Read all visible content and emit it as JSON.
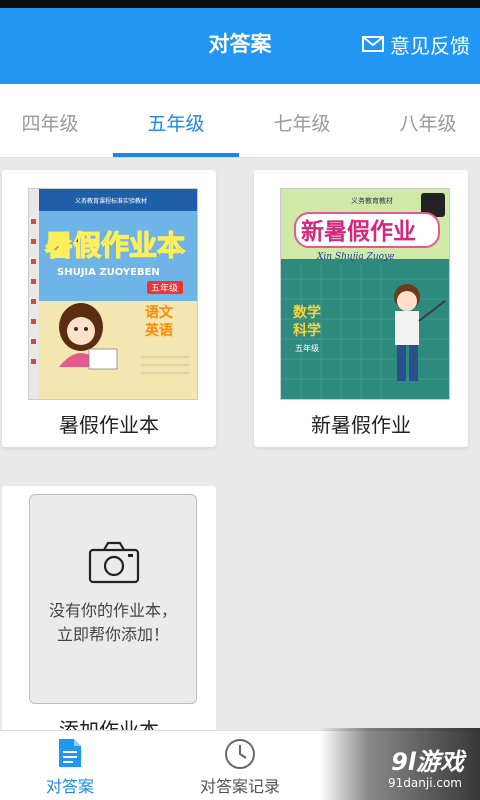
{
  "header": {
    "title": "对答案",
    "feedback_label": "意见反馈"
  },
  "grade_tabs": [
    {
      "label": "四年级",
      "active": false
    },
    {
      "label": "五年级",
      "active": true
    },
    {
      "label": "七年级",
      "active": false
    },
    {
      "label": "八年级",
      "active": false
    }
  ],
  "books": [
    {
      "title": "暑假作业本",
      "cover": {
        "heading": "暑假作业本",
        "pinyin": "SHUJIA ZUOYEBEN",
        "grade": "五年级",
        "subjects": [
          "语文",
          "英语"
        ],
        "series": "义务教育课程标准实验教材"
      }
    },
    {
      "title": "新暑假作业",
      "cover": {
        "heading": "新暑假作业",
        "pinyin": "Xin Shujia Zuoye",
        "grade": "五年级",
        "subjects": [
          "数学",
          "科学"
        ],
        "series": "义务教育教材"
      }
    }
  ],
  "add_card": {
    "text_line1": "没有你的作业本，",
    "text_line2": "立即帮你添加！",
    "label": "添加作业本"
  },
  "bottom_nav": {
    "items": [
      {
        "label": "对答案",
        "active": true
      },
      {
        "label": "对答案记录",
        "active": false
      }
    ]
  },
  "watermark": {
    "main": "9l游戏",
    "sub": "91danji.com"
  },
  "colors": {
    "primary": "#2196f3",
    "active_tab": "#1e88e5"
  }
}
